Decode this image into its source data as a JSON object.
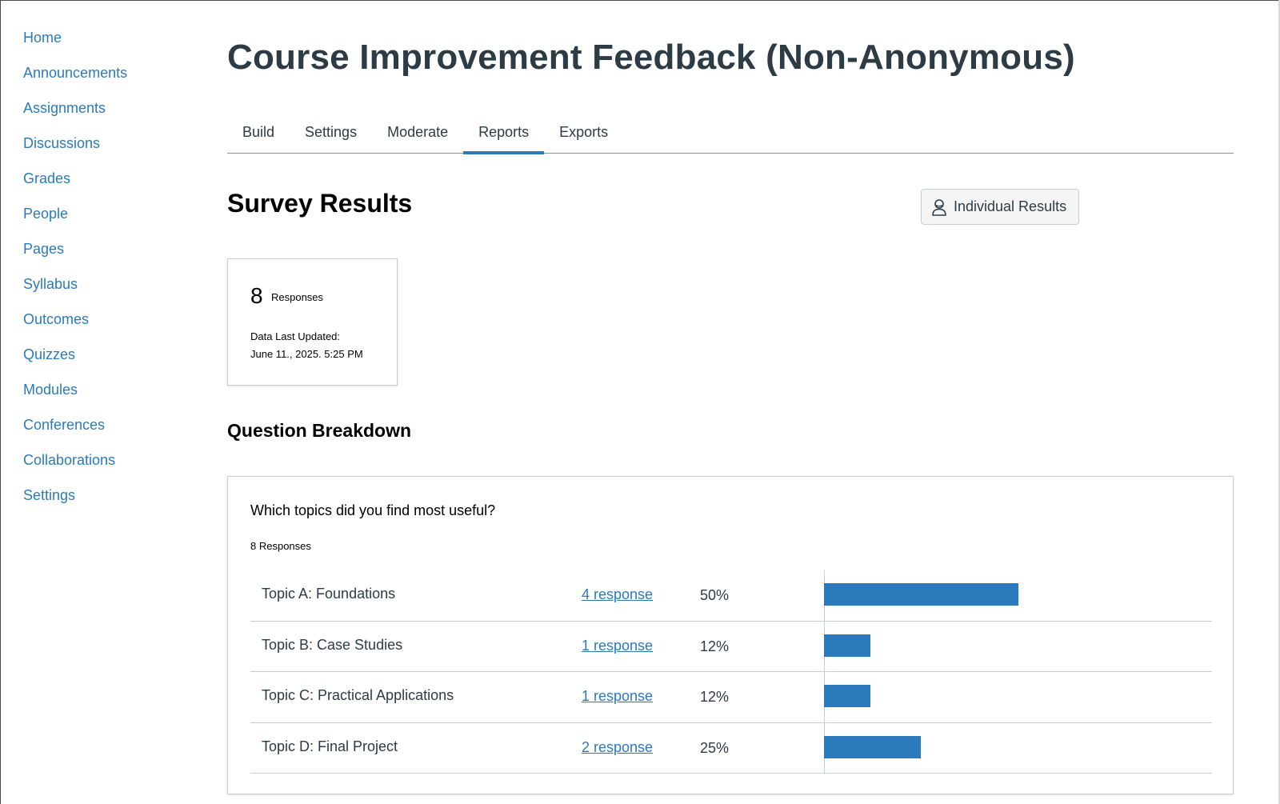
{
  "sidebar": {
    "items": [
      {
        "label": "Home"
      },
      {
        "label": "Announcements"
      },
      {
        "label": "Assignments"
      },
      {
        "label": "Discussions"
      },
      {
        "label": "Grades"
      },
      {
        "label": "People"
      },
      {
        "label": "Pages"
      },
      {
        "label": "Syllabus"
      },
      {
        "label": "Outcomes"
      },
      {
        "label": "Quizzes"
      },
      {
        "label": "Modules"
      },
      {
        "label": "Conferences"
      },
      {
        "label": "Collaborations"
      },
      {
        "label": "Settings"
      }
    ]
  },
  "page": {
    "title": "Course Improvement Feedback (Non-Anonymous)"
  },
  "tabs": [
    {
      "label": "Build",
      "active": false
    },
    {
      "label": "Settings",
      "active": false
    },
    {
      "label": "Moderate",
      "active": false
    },
    {
      "label": "Reports",
      "active": true
    },
    {
      "label": "Exports",
      "active": false
    }
  ],
  "results": {
    "title": "Survey Results",
    "individual_button": "Individual Results",
    "response_count": "8",
    "response_label": "Responses",
    "updated_label": "Data Last Updated:",
    "updated_value": "June 11., 2025. 5:25 PM"
  },
  "breakdown": {
    "title": "Question Breakdown",
    "question": "Which topics did you find most useful?",
    "question_responses": "8 Responses"
  },
  "chart_data": {
    "type": "bar",
    "orientation": "horizontal",
    "categories": [
      "Topic A: Foundations",
      "Topic B: Case Studies",
      "Topic C: Practical Applications",
      "Topic D: Final Project"
    ],
    "responses_text": [
      "4 response",
      "1 response",
      "1 response",
      "2 response"
    ],
    "percent_text": [
      "50%",
      "12%",
      "12%",
      "25%"
    ],
    "values": [
      50,
      12,
      12,
      25
    ],
    "xlim": [
      0,
      100
    ],
    "bar_color": "#2b7abc"
  },
  "colors": {
    "accent": "#2b7abc",
    "text": "#2d3b45",
    "border": "#c7cdd1"
  }
}
